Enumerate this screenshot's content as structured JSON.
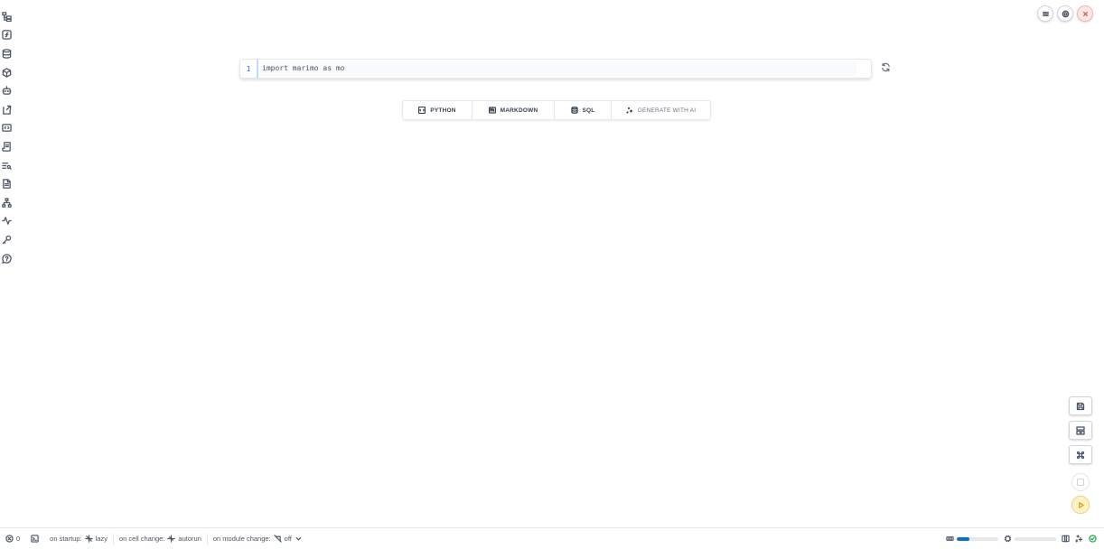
{
  "sidebar": {
    "items": [
      {
        "name": "file-explorer-icon"
      },
      {
        "name": "variables-icon"
      },
      {
        "name": "datasources-icon"
      },
      {
        "name": "packages-icon"
      },
      {
        "name": "ai-assistant-icon"
      },
      {
        "name": "snippets-icon"
      },
      {
        "name": "scratchpad-icon"
      },
      {
        "name": "documentation-icon"
      },
      {
        "name": "outline-icon"
      },
      {
        "name": "notes-icon"
      },
      {
        "name": "dependencies-icon"
      },
      {
        "name": "tracing-icon"
      },
      {
        "name": "secrets-icon"
      },
      {
        "name": "help-icon"
      }
    ]
  },
  "cell": {
    "line_number": "1",
    "code": "import marimo as mo"
  },
  "add_cell_toolbar": {
    "python_label": "PYTHON",
    "markdown_label": "MARKDOWN",
    "sql_label": "SQL",
    "ai_label": "GENERATE WITH AI"
  },
  "footer": {
    "error_count": "0",
    "startup_label": "on startup:",
    "startup_value": "lazy",
    "cell_change_label": "on cell change:",
    "cell_change_value": "autorun",
    "module_change_label": "on module change:",
    "module_change_value": "off",
    "memory_usage": 0.3,
    "cpu_usage": 0.0
  },
  "colors": {
    "accent": "#0b70c9",
    "run_button": "#fef3c7",
    "close_button": "#e05252",
    "status_ok": "#16a34a"
  }
}
